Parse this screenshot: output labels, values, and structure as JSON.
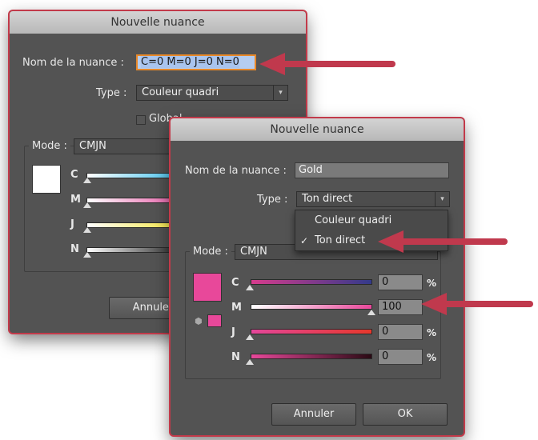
{
  "back_dialog": {
    "title": "Nouvelle nuance",
    "name_label": "Nom de la nuance :",
    "name_value": "C=0 M=0 J=0 N=0",
    "type_label": "Type :",
    "type_value": "Couleur quadri",
    "global_label": "Global",
    "mode_label": "Mode :",
    "mode_value": "CMJN",
    "channels": [
      "C",
      "M",
      "J",
      "N"
    ],
    "cancel_label": "Annuler"
  },
  "front_dialog": {
    "title": "Nouvelle nuance",
    "name_label": "Nom de la nuance :",
    "name_value": "Gold",
    "type_label": "Type :",
    "type_value": "Ton direct",
    "type_menu": {
      "options": [
        "Couleur quadri",
        "Ton direct"
      ],
      "selected": "Ton direct"
    },
    "mode_label": "Mode :",
    "mode_value": "CMJN",
    "channels": [
      {
        "label": "C",
        "value": "0",
        "unit": "%",
        "level": 0
      },
      {
        "label": "M",
        "value": "100",
        "unit": "",
        "level": 100
      },
      {
        "label": "J",
        "value": "0",
        "unit": "%",
        "level": 0
      },
      {
        "label": "N",
        "value": "0",
        "unit": "%",
        "level": 0
      }
    ],
    "swatch_color": "#e8489a",
    "cancel_label": "Annuler",
    "ok_label": "OK"
  },
  "colors": {
    "arrow": "#c0394d",
    "dialog_border": "#c23a4a",
    "panel": "#535353"
  }
}
